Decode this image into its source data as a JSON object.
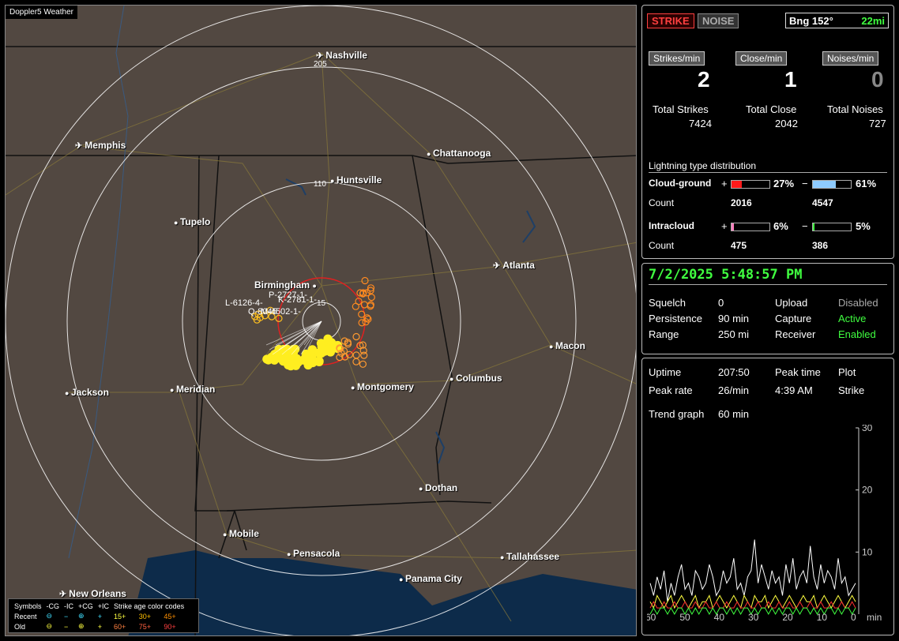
{
  "map": {
    "title": "Doppler5 Weather",
    "cities": [
      {
        "name": "Nashville",
        "icon": "airport-icon"
      },
      {
        "name": "Memphis",
        "icon": "airport-icon"
      },
      {
        "name": "Chattanooga",
        "icon": "city-dot-icon"
      },
      {
        "name": "Huntsville",
        "icon": "city-dot-icon"
      },
      {
        "name": "Tupelo",
        "icon": "city-dot-icon"
      },
      {
        "name": "Atlanta",
        "icon": "airport-icon"
      },
      {
        "name": "Birmingham",
        "icon": "city-dot-icon"
      },
      {
        "name": "Macon",
        "icon": "city-dot-icon"
      },
      {
        "name": "Columbus",
        "icon": "city-dot-icon"
      },
      {
        "name": "Montgomery",
        "icon": "city-dot-icon"
      },
      {
        "name": "Jackson",
        "icon": "city-dot-icon"
      },
      {
        "name": "Meridian",
        "icon": "city-dot-icon"
      },
      {
        "name": "Dothan",
        "icon": "city-dot-icon"
      },
      {
        "name": "Mobile",
        "icon": "city-dot-icon"
      },
      {
        "name": "Pensacola",
        "icon": "city-dot-icon"
      },
      {
        "name": "Tallahassee",
        "icon": "city-dot-icon"
      },
      {
        "name": "Panama City",
        "icon": "city-dot-icon"
      },
      {
        "name": "New Orleans",
        "icon": "airport-icon"
      }
    ],
    "range_labels": [
      "205",
      "110",
      "15"
    ],
    "cell_labels": [
      "P-2727-1-",
      "K-2781-1-",
      "L-6126-4-",
      "Q-8045",
      "M-4502-1-"
    ],
    "legend": {
      "symbols_label": "Symbols",
      "cols": [
        "-CG",
        "-IC",
        "+CG",
        "+IC"
      ],
      "recent_label": "Recent",
      "old_label": "Old",
      "recent_symbols": [
        "⊖",
        "−",
        "⊕",
        "+"
      ],
      "old_symbols": [
        "⊖",
        "−",
        "⊕",
        "+"
      ],
      "age_title": "Strike age color codes",
      "age_recent": [
        "15+",
        "30+",
        "45+"
      ],
      "age_old": [
        "60+",
        "75+",
        "90+"
      ]
    }
  },
  "stats": {
    "strike_btn": "STRIKE",
    "noise_btn": "NOISE",
    "bearing": "Bng 152°",
    "distance": "22mi",
    "strikes_min_label": "Strikes/min",
    "close_min_label": "Close/min",
    "noises_min_label": "Noises/min",
    "strikes_min": "2",
    "close_min": "1",
    "noises_min": "0",
    "total_strikes_label": "Total Strikes",
    "total_close_label": "Total Close",
    "total_noises_label": "Total Noises",
    "total_strikes": "7424",
    "total_close": "2042",
    "total_noises": "727",
    "dist_title": "Lightning type distribution",
    "cg_label": "Cloud-ground",
    "ic_label": "Intracloud",
    "count_label": "Count",
    "plus": "+",
    "minus": "−",
    "cg_pos_pct": "27%",
    "cg_neg_pct": "61%",
    "cg_pos_count": "2016",
    "cg_neg_count": "4547",
    "ic_pos_pct": "6%",
    "ic_neg_pct": "5%",
    "ic_pos_count": "475",
    "ic_neg_count": "386",
    "bar_fracs": {
      "cg_pos": 0.27,
      "cg_neg": 0.61,
      "ic_pos": 0.06,
      "ic_neg": 0.05
    },
    "colors": {
      "cg_pos": "#ff1a1a",
      "cg_neg": "#8ecbff",
      "ic_pos": "#ff80c0",
      "ic_neg": "#40ff40"
    }
  },
  "status": {
    "datetime": "7/2/2025 5:48:57 PM",
    "squelch_label": "Squelch",
    "squelch": "0",
    "upload_label": "Upload",
    "upload": "Disabled",
    "persistence_label": "Persistence",
    "persistence": "90 min",
    "capture_label": "Capture",
    "capture": "Active",
    "range_label": "Range",
    "range": "250 mi",
    "receiver_label": "Receiver",
    "receiver": "Enabled"
  },
  "trend": {
    "uptime_label": "Uptime",
    "uptime": "207:50",
    "peak_time_label": "Peak time",
    "plot_label": "Plot",
    "peak_rate_label": "Peak rate",
    "peak_rate": "26/min",
    "peak_time": "4:39 AM",
    "plot": "Strike",
    "trend_label": "Trend graph",
    "trend_value": "60 min",
    "y_ticks": [
      "30",
      "20",
      "10"
    ],
    "x_ticks": [
      "60",
      "50",
      "40",
      "30",
      "20",
      "10",
      "0"
    ],
    "x_unit": "min"
  },
  "chart_data": {
    "type": "line",
    "xlabel": "min",
    "ylim": [
      0,
      30
    ],
    "xlim": [
      60,
      0
    ],
    "series": [
      {
        "color": "#ffffff",
        "values": [
          5,
          3,
          6,
          4,
          7,
          2,
          5,
          3,
          6,
          8,
          4,
          5,
          3,
          7,
          6,
          4,
          5,
          8,
          6,
          3,
          4,
          7,
          5,
          6,
          9,
          4,
          5,
          3,
          6,
          7,
          12,
          5,
          8,
          6,
          4,
          7,
          5,
          6,
          3,
          8,
          5,
          9,
          4,
          6,
          7,
          5,
          11,
          6,
          4,
          8,
          5,
          7,
          6,
          4,
          9,
          5,
          6,
          3,
          4,
          5
        ]
      },
      {
        "color": "#ffff40",
        "values": [
          2,
          1,
          3,
          2,
          1,
          2,
          3,
          1,
          2,
          3,
          2,
          1,
          2,
          3,
          1,
          2,
          2,
          3,
          1,
          2,
          3,
          2,
          1,
          2,
          3,
          2,
          1,
          3,
          2,
          1,
          3,
          2,
          2,
          3,
          1,
          2,
          3,
          2,
          1,
          2,
          3,
          2,
          1,
          2,
          3,
          2,
          2,
          3,
          1,
          2,
          3,
          2,
          1,
          2,
          3,
          2,
          1,
          2,
          3,
          2
        ]
      },
      {
        "color": "#ff3030",
        "values": [
          1,
          2,
          1,
          1,
          2,
          1,
          1,
          2,
          1,
          1,
          2,
          1,
          1,
          2,
          1,
          1,
          2,
          1,
          1,
          2,
          1,
          1,
          2,
          1,
          1,
          2,
          1,
          1,
          2,
          1,
          1,
          2,
          1,
          1,
          2,
          1,
          1,
          2,
          1,
          1,
          2,
          1,
          1,
          2,
          1,
          1,
          2,
          1,
          1,
          2,
          1,
          1,
          2,
          1,
          1,
          2,
          1,
          1,
          2,
          1
        ]
      },
      {
        "color": "#40ff40",
        "values": [
          0,
          1,
          0,
          1,
          1,
          0,
          1,
          0,
          1,
          1,
          0,
          1,
          0,
          1,
          0,
          1,
          1,
          0,
          1,
          0,
          1,
          1,
          0,
          1,
          0,
          1,
          0,
          1,
          1,
          0,
          1,
          0,
          1,
          1,
          0,
          1,
          0,
          1,
          0,
          1,
          1,
          0,
          1,
          0,
          1,
          1,
          0,
          1,
          0,
          1,
          0,
          1,
          1,
          0,
          1,
          0,
          1,
          1,
          0,
          1
        ]
      }
    ]
  }
}
